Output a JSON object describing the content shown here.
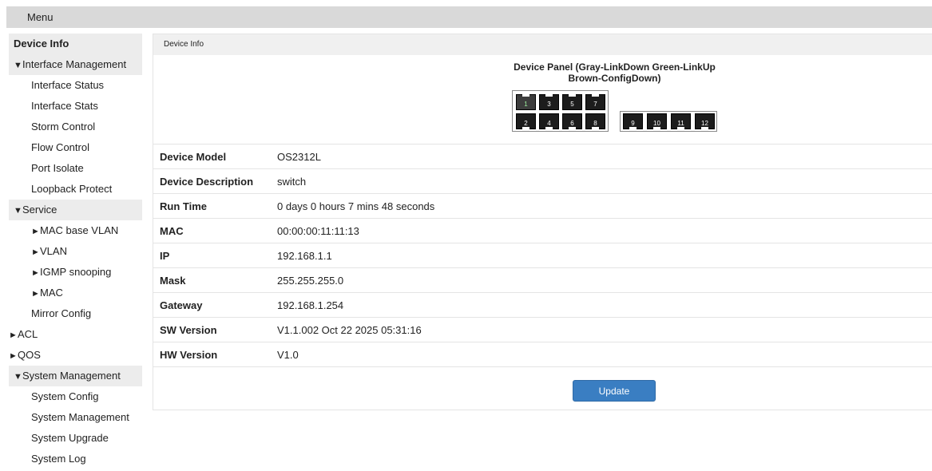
{
  "topbar": {
    "menu_label": "Menu"
  },
  "sidebar": {
    "items": [
      {
        "label": "Device Info",
        "level": "head-bold"
      },
      {
        "label": "Interface Management",
        "level": "head",
        "arrow": "▼"
      },
      {
        "label": "Interface Status",
        "level": "l1"
      },
      {
        "label": "Interface Stats",
        "level": "l1"
      },
      {
        "label": "Storm Control",
        "level": "l1"
      },
      {
        "label": "Flow Control",
        "level": "l1"
      },
      {
        "label": "Port Isolate",
        "level": "l1"
      },
      {
        "label": "Loopback Protect",
        "level": "l1"
      },
      {
        "label": "Service",
        "level": "head",
        "arrow": "▼"
      },
      {
        "label": "MAC base VLAN",
        "level": "l2",
        "arrow": "►"
      },
      {
        "label": "VLAN",
        "level": "l2",
        "arrow": "►"
      },
      {
        "label": "IGMP snooping",
        "level": "l2",
        "arrow": "►"
      },
      {
        "label": "MAC",
        "level": "l2",
        "arrow": "►"
      },
      {
        "label": "Mirror Config",
        "level": "l1"
      },
      {
        "label": "ACL",
        "level": "top",
        "arrow": "►"
      },
      {
        "label": "QOS",
        "level": "top",
        "arrow": "►"
      },
      {
        "label": "System Management",
        "level": "head",
        "arrow": "▼"
      },
      {
        "label": "System Config",
        "level": "l1"
      },
      {
        "label": "System Management",
        "level": "l1"
      },
      {
        "label": "System Upgrade",
        "level": "l1"
      },
      {
        "label": "System Log",
        "level": "l1"
      }
    ]
  },
  "panel": {
    "header": "Device Info",
    "device_panel_title_line1": "Device Panel (Gray-LinkDown Green-LinkUp",
    "device_panel_title_line2": "Brown-ConfigDown)",
    "ports": [
      {
        "num": "1",
        "status": "up"
      },
      {
        "num": "2",
        "status": "down"
      },
      {
        "num": "3",
        "status": "down"
      },
      {
        "num": "4",
        "status": "down"
      },
      {
        "num": "5",
        "status": "down"
      },
      {
        "num": "6",
        "status": "down"
      },
      {
        "num": "7",
        "status": "down"
      },
      {
        "num": "8",
        "status": "down"
      },
      {
        "num": "9",
        "status": "down"
      },
      {
        "num": "10",
        "status": "down"
      },
      {
        "num": "11",
        "status": "down"
      },
      {
        "num": "12",
        "status": "down"
      }
    ],
    "rows": [
      {
        "key": "Device Model",
        "value": "OS2312L"
      },
      {
        "key": "Device Description",
        "value": "switch"
      },
      {
        "key": "Run Time",
        "value": "0 days 0 hours 7 mins 48 seconds"
      },
      {
        "key": "MAC",
        "value": "00:00:00:11:11:13"
      },
      {
        "key": "IP",
        "value": "192.168.1.1"
      },
      {
        "key": "Mask",
        "value": "255.255.255.0"
      },
      {
        "key": "Gateway",
        "value": "192.168.1.254"
      },
      {
        "key": "SW Version",
        "value": "V1.1.002 Oct 22 2025 05:31:16"
      },
      {
        "key": "HW Version",
        "value": "V1.0"
      }
    ],
    "update_label": "Update"
  }
}
